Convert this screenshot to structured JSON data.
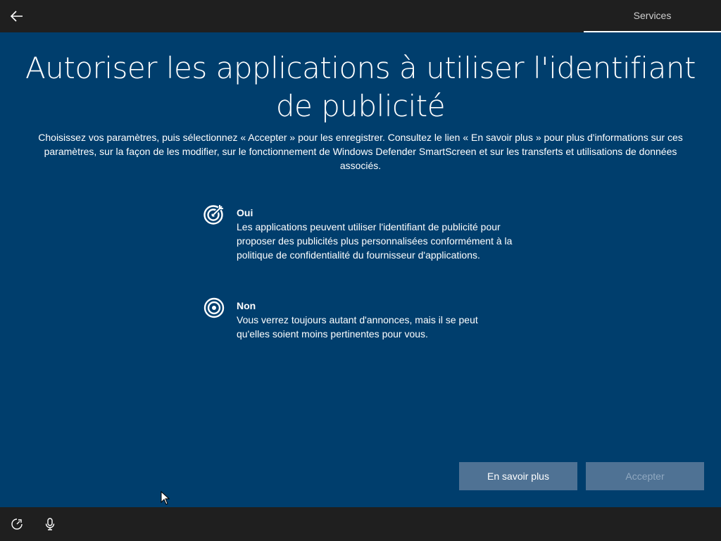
{
  "header": {
    "back_icon": "arrow-left-icon",
    "tab_label": "Services"
  },
  "main": {
    "title": "Autoriser les applications à utiliser l'identifiant de publicité",
    "description": "Choisissez vos paramètres, puis sélectionnez « Accepter » pour les enregistrer. Consultez le lien « En savoir plus » pour plus d'informations sur ces paramètres, sur la façon de les modifier, sur le fonctionnement de Windows Defender SmartScreen et sur les transferts et utilisations de données associés.",
    "options": [
      {
        "label": "Oui",
        "icon": "target-arrow-icon",
        "body": "Les applications peuvent utiliser l'identifiant de publicité pour proposer des publicités plus personnalisées conformément à la politique de confidentialité du fournisseur d'applications."
      },
      {
        "label": "Non",
        "icon": "target-icon",
        "body": "Vous verrez toujours autant d'annonces, mais il se peut qu'elles soient moins pertinentes pour vous."
      }
    ]
  },
  "footer": {
    "learn_more_label": "En savoir plus",
    "accept_label": "Accepter",
    "ease_of_access_icon": "ease-of-access-icon",
    "microphone_icon": "microphone-icon"
  },
  "colors": {
    "background": "#003e6d",
    "bar": "#1f1f1f",
    "button": "#4f7294"
  }
}
